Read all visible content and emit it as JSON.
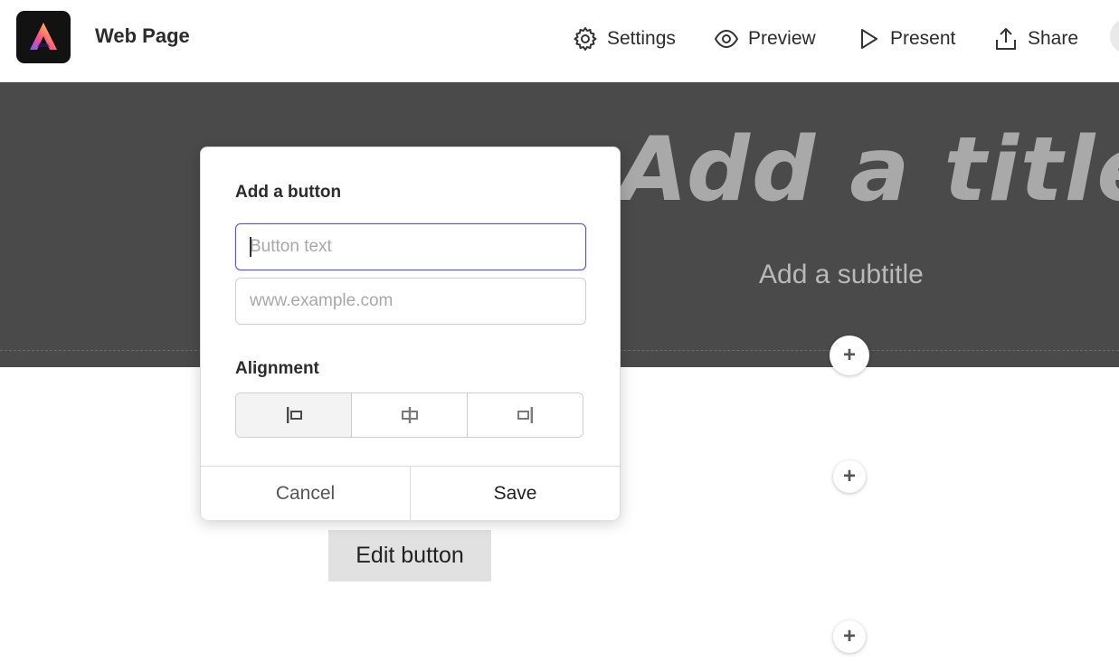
{
  "header": {
    "page_title": "Web Page",
    "nav": [
      {
        "label": "Settings",
        "icon": "gear-icon"
      },
      {
        "label": "Preview",
        "icon": "eye-icon"
      },
      {
        "label": "Present",
        "icon": "play-icon"
      },
      {
        "label": "Share",
        "icon": "share-icon"
      }
    ]
  },
  "hero": {
    "title": "Add a title",
    "subtitle": "Add a subtitle"
  },
  "canvas": {
    "edit_button_label": "Edit button",
    "add_icon": "+"
  },
  "dialog": {
    "heading": "Add a button",
    "button_text_placeholder": "Button text",
    "url_placeholder": "www.example.com",
    "alignment_label": "Alignment",
    "alignment_options": [
      "left",
      "center",
      "right"
    ],
    "alignment_selected": "left",
    "cancel_label": "Cancel",
    "save_label": "Save"
  },
  "colors": {
    "hero_bg": "#4a4a4a",
    "focus_ring": "#5c52d6",
    "logo_bg": "#121212"
  }
}
